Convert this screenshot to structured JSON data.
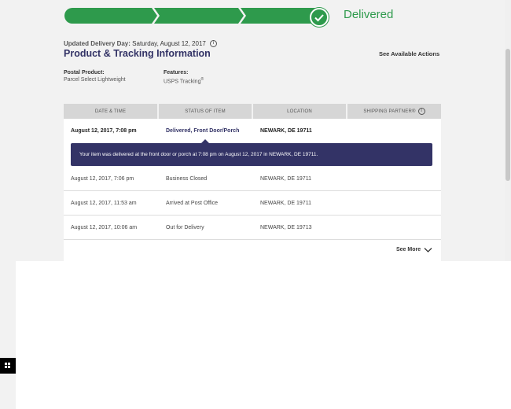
{
  "tracking": {
    "status": "Delivered",
    "updated_label": "Updated Delivery Day:",
    "updated_value": "Saturday, August 12, 2017",
    "section_title": "Product & Tracking Information",
    "actions_link": "See Available Actions",
    "postal_product_label": "Postal Product:",
    "postal_product_value": "Parcel Select Lightweight",
    "features_label": "Features:",
    "features_value": "USPS Tracking",
    "features_mark": "®"
  },
  "table": {
    "headers": [
      "DATE & TIME",
      "STATUS OF ITEM",
      "LOCATION",
      "SHIPPING PARTNER®"
    ],
    "rows": [
      {
        "date": "August 12, 2017, 7:08 pm",
        "status": "Delivered, Front Door/Porch",
        "location": "NEWARK, DE 19711"
      },
      {
        "date": "August 12, 2017, 7:06 pm",
        "status": "Business Closed",
        "location": "NEWARK, DE 19711"
      },
      {
        "date": "August 12, 2017, 11:53 am",
        "status": "Arrived at Post Office",
        "location": "NEWARK, DE 19711"
      },
      {
        "date": "August 12, 2017, 10:06 am",
        "status": "Out for Delivery",
        "location": "NEWARK, DE 19713"
      }
    ],
    "detail": "Your item was delivered at the front door or porch at 7:08 pm on August 12, 2017 in NEWARK, DE 19711.",
    "see_more": "See More"
  },
  "colors": {
    "progress_green": "#2e9a4c",
    "title_navy": "#333366"
  }
}
